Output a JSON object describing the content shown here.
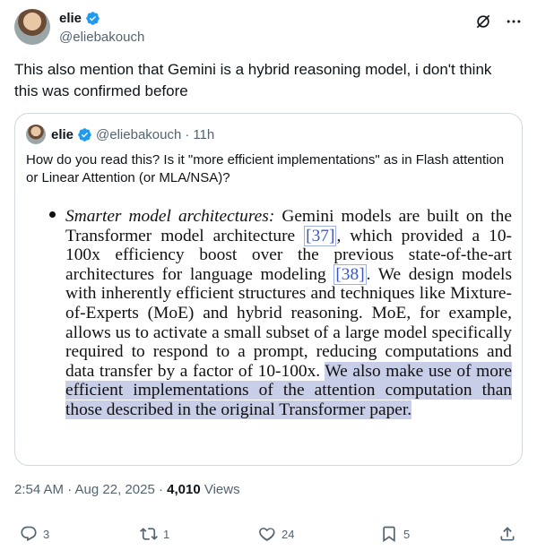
{
  "author": {
    "name": "elie",
    "handle": "@eliebakouch"
  },
  "tweet": {
    "text": "This also mention that Gemini is a hybrid reasoning model, i don't think this was confirmed before",
    "timestamp": "2:54 AM · Aug 22, 2025 · ",
    "views_count": "4,010",
    "views_label": " Views"
  },
  "quoted": {
    "name": "elie",
    "handle": "@eliebakouch",
    "separator": "·",
    "time": "11h",
    "text": "How do you read this? Is it \"more efficient implementations\" as in Flash attention or Linear Attention (or MLA/NSA)?",
    "image": {
      "heading": "Smarter model architectures:",
      "p1": " Gemini models are built on the Transformer model architecture ",
      "ref1": "[37]",
      "p2": ", which provided a 10-100x efficiency boost over the previous state-of-the-art architectures for language modeling ",
      "ref2": "[38]",
      "p3": ". We design models with inherently efficient structures and techniques like Mixture-of-Experts (MoE) and hybrid reasoning. MoE, for example, allows us to activate a small subset of a large model specifically required to respond to a prompt, reducing computations and data transfer by a factor of 10-100x. ",
      "highlight": "We also make use of more efficient implementations of the attention computation than those described in the original Transformer paper."
    }
  },
  "actions": {
    "replies": "3",
    "reposts": "1",
    "likes": "24",
    "bookmarks": "5"
  },
  "icons": [
    "verified-badge-icon",
    "grok-icon",
    "more-icon",
    "reply-icon",
    "repost-icon",
    "like-icon",
    "bookmark-icon",
    "share-icon"
  ],
  "colors": {
    "verified": "#1d9bf0",
    "secondary_text": "#536471",
    "highlight": "#c8cde8",
    "ref_link": "#3a59c8"
  }
}
